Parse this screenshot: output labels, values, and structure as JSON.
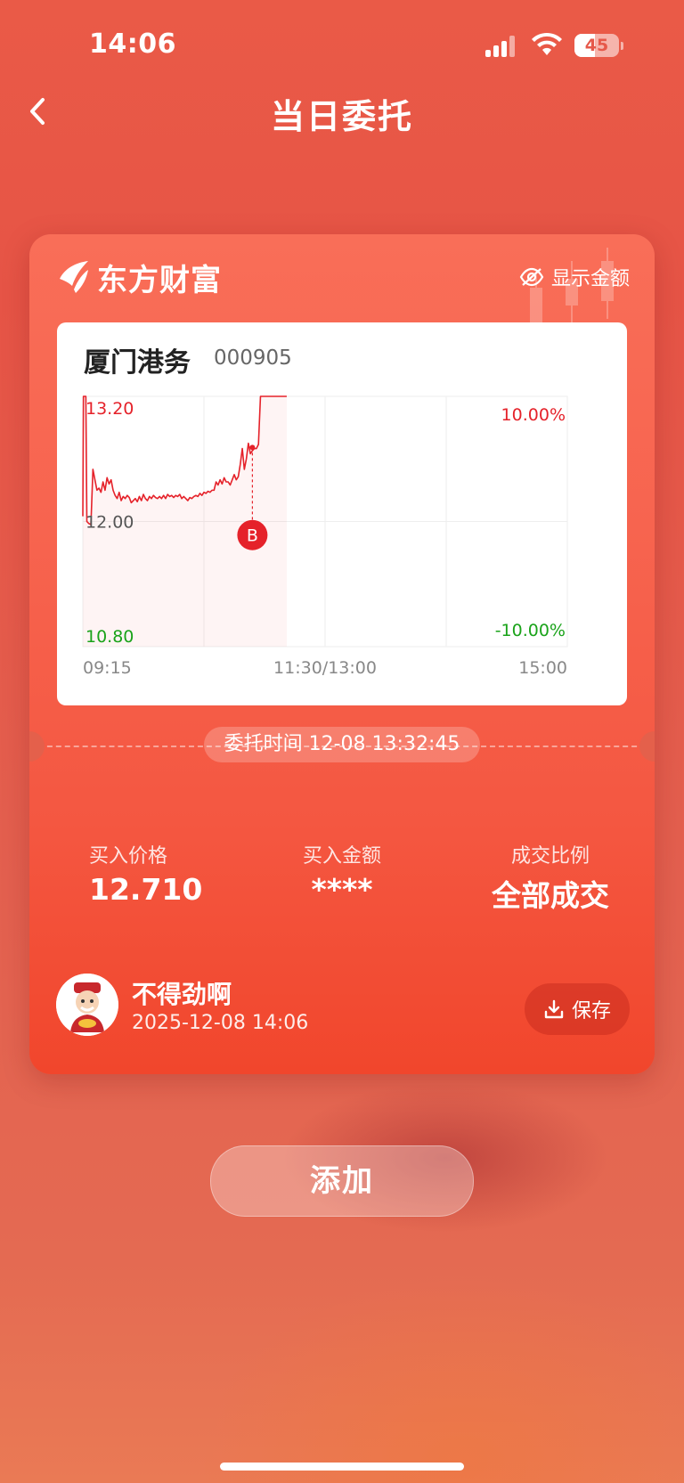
{
  "status_bar": {
    "time": "14:06",
    "battery": "45",
    "battery_level": 0.45
  },
  "nav": {
    "title": "当日委托"
  },
  "card": {
    "brand": "东方财富",
    "show_amount_label": "显示金额",
    "stock": {
      "name": "厦门港务",
      "code": "000905"
    },
    "order_time": "委托时间 12-08 13:32:45",
    "stats": [
      {
        "label": "买入价格",
        "value": "12.710"
      },
      {
        "label": "买入金额",
        "value": "****"
      },
      {
        "label": "成交比例",
        "value": "全部成交"
      }
    ],
    "user": {
      "name": "不得劲啊",
      "datetime": "2025-12-08 14:06"
    },
    "save_label": "保存"
  },
  "chart_data": {
    "type": "line",
    "series": [
      {
        "values": [
          [
            0,
            12.05
          ],
          [
            0.3,
            13.2
          ],
          [
            1.5,
            13.2
          ],
          [
            2,
            12.0
          ],
          [
            3,
            11.98
          ],
          [
            4,
            11.97
          ],
          [
            5,
            12.5
          ],
          [
            6,
            12.4
          ],
          [
            7,
            12.3
          ],
          [
            8,
            12.32
          ],
          [
            9,
            12.28
          ],
          [
            10,
            12.38
          ],
          [
            11,
            12.3
          ],
          [
            12,
            12.42
          ],
          [
            13,
            12.36
          ],
          [
            14,
            12.4
          ],
          [
            15,
            12.3
          ],
          [
            16,
            12.25
          ],
          [
            17,
            12.22
          ],
          [
            18,
            12.28
          ],
          [
            19,
            12.2
          ],
          [
            20,
            12.24
          ],
          [
            21,
            12.22
          ],
          [
            22,
            12.25
          ],
          [
            23,
            12.23
          ],
          [
            24,
            12.18
          ],
          [
            25,
            12.2
          ],
          [
            26,
            12.22
          ],
          [
            27,
            12.19
          ],
          [
            28,
            12.24
          ],
          [
            29,
            12.2
          ],
          [
            30,
            12.26
          ],
          [
            31,
            12.22
          ],
          [
            32,
            12.2
          ],
          [
            33,
            12.24
          ],
          [
            34,
            12.22
          ],
          [
            35,
            12.25
          ],
          [
            36,
            12.23
          ],
          [
            37,
            12.22
          ],
          [
            38,
            12.24
          ],
          [
            39,
            12.22
          ],
          [
            40,
            12.25
          ],
          [
            41,
            12.22
          ],
          [
            42,
            12.26
          ],
          [
            43,
            12.24
          ],
          [
            44,
            12.25
          ],
          [
            45,
            12.23
          ],
          [
            46,
            12.25
          ],
          [
            47,
            12.24
          ],
          [
            48,
            12.26
          ],
          [
            49,
            12.22
          ],
          [
            50,
            12.24
          ],
          [
            51,
            12.22
          ],
          [
            52,
            12.2
          ],
          [
            53,
            12.23
          ],
          [
            54,
            12.22
          ],
          [
            55,
            12.24
          ],
          [
            56,
            12.25
          ],
          [
            57,
            12.24
          ],
          [
            58,
            12.27
          ],
          [
            59,
            12.25
          ],
          [
            60,
            12.28
          ],
          [
            61,
            12.27
          ],
          [
            62,
            12.29
          ],
          [
            63,
            12.28
          ],
          [
            64,
            12.3
          ],
          [
            65,
            12.3
          ],
          [
            66,
            12.38
          ],
          [
            67,
            12.35
          ],
          [
            68,
            12.4
          ],
          [
            69,
            12.36
          ],
          [
            70,
            12.42
          ],
          [
            71,
            12.38
          ],
          [
            72,
            12.38
          ],
          [
            73,
            12.35
          ],
          [
            74,
            12.4
          ],
          [
            75,
            12.45
          ],
          [
            76,
            12.4
          ],
          [
            77,
            12.43
          ],
          [
            78,
            12.55
          ],
          [
            79,
            12.7
          ],
          [
            80,
            12.5
          ],
          [
            81,
            12.6
          ],
          [
            82,
            12.75
          ],
          [
            83,
            12.65
          ],
          [
            84,
            12.68
          ],
          [
            85,
            12.7
          ],
          [
            86,
            12.7
          ],
          [
            87,
            12.74
          ],
          [
            88,
            13.2
          ],
          [
            90,
            13.2
          ],
          [
            95,
            13.2
          ],
          [
            100,
            13.2
          ],
          [
            101,
            13.2
          ]
        ]
      }
    ],
    "buy_marker": {
      "x": 84,
      "price": 12.71,
      "label": "B"
    },
    "x_range": [
      0,
      240
    ],
    "x_tick_labels": [
      "09:15",
      "11:30/13:00",
      "15:00"
    ],
    "y_range": [
      10.8,
      13.2
    ],
    "y_left_labels": [
      "13.20",
      "12.00",
      "10.80"
    ],
    "y_right_labels": [
      "10.00%",
      "-10.00%"
    ],
    "colors": {
      "line": "#e5222a",
      "up": "#e5222a",
      "down": "#1aa31a"
    }
  },
  "add_label": "添加"
}
